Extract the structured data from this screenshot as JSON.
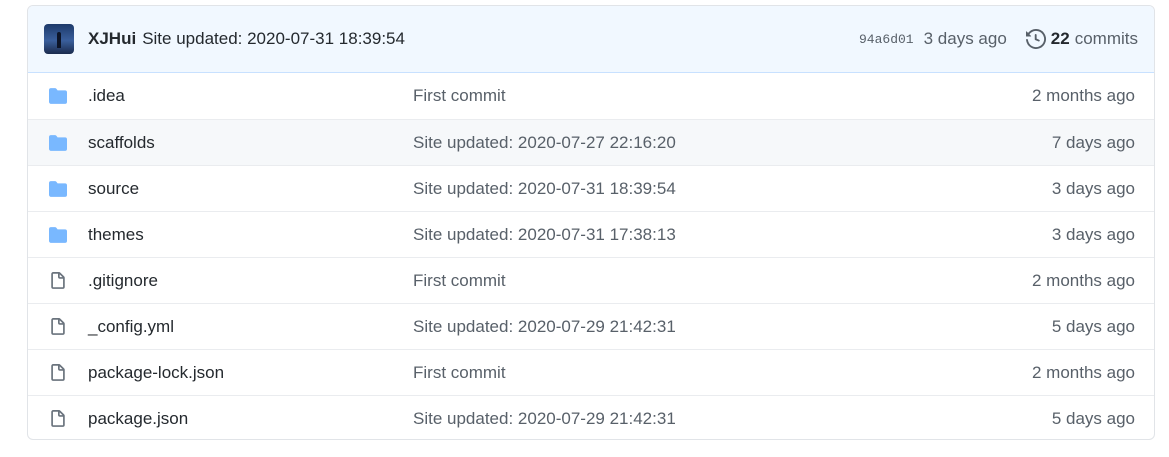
{
  "colors": {
    "folder": "#79b8ff",
    "file": "#6a737d",
    "header_bg": "#f1f8ff"
  },
  "latest_commit": {
    "author": "XJHui",
    "message": "Site updated: 2020-07-31 18:39:54",
    "sha": "94a6d01",
    "age": "3 days ago",
    "commits_count": "22",
    "commits_label": "commits",
    "history_icon": "history-icon"
  },
  "files": [
    {
      "type": "folder",
      "icon": "folder-icon",
      "name": ".idea",
      "message": "First commit",
      "age": "2 months ago"
    },
    {
      "type": "folder",
      "icon": "folder-icon",
      "name": "scaffolds",
      "message": "Site updated: 2020-07-27 22:16:20",
      "age": "7 days ago"
    },
    {
      "type": "folder",
      "icon": "folder-icon",
      "name": "source",
      "message": "Site updated: 2020-07-31 18:39:54",
      "age": "3 days ago"
    },
    {
      "type": "folder",
      "icon": "folder-icon",
      "name": "themes",
      "message": "Site updated: 2020-07-31 17:38:13",
      "age": "3 days ago"
    },
    {
      "type": "file",
      "icon": "file-icon",
      "name": ".gitignore",
      "message": "First commit",
      "age": "2 months ago"
    },
    {
      "type": "file",
      "icon": "file-icon",
      "name": "_config.yml",
      "message": "Site updated: 2020-07-29 21:42:31",
      "age": "5 days ago"
    },
    {
      "type": "file",
      "icon": "file-icon",
      "name": "package-lock.json",
      "message": "First commit",
      "age": "2 months ago"
    },
    {
      "type": "file",
      "icon": "file-icon",
      "name": "package.json",
      "message": "Site updated: 2020-07-29 21:42:31",
      "age": "5 days ago"
    }
  ]
}
